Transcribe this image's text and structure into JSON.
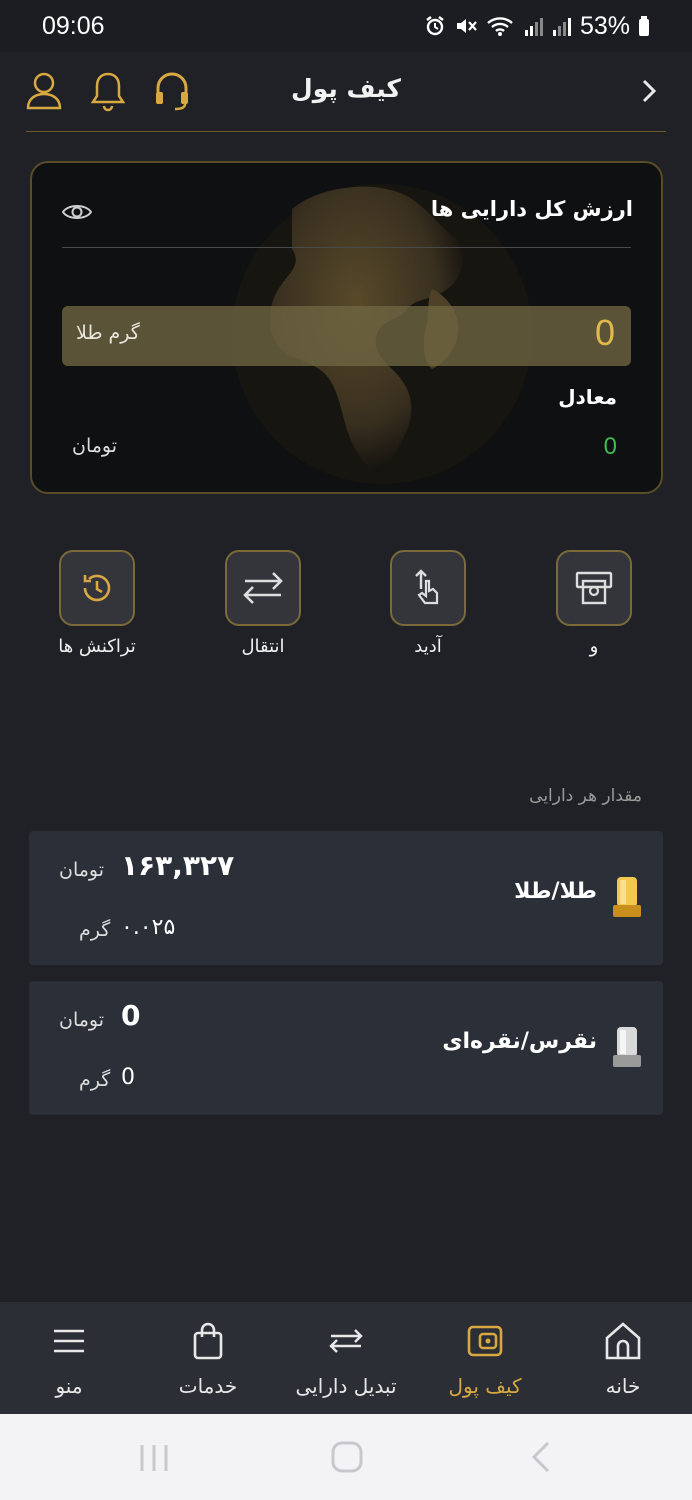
{
  "status_bar": {
    "time": "09:06",
    "battery": "53%"
  },
  "header": {
    "title": "کیف پول"
  },
  "total_card": {
    "title": "ارزش کل دارایی ها",
    "gold_amount": "0",
    "gold_unit": "گرم طلا",
    "equivalent_label": "معادل",
    "toman_value": "0",
    "toman_unit": "تومان"
  },
  "actions": [
    {
      "label": "و",
      "icon": "deposit-icon"
    },
    {
      "label": "آدید",
      "icon": "withdraw-icon"
    },
    {
      "label": "انتقال",
      "icon": "transfer-icon"
    },
    {
      "label": "تراکنش ها",
      "icon": "history-icon"
    }
  ],
  "assets_section": {
    "label": "مقدار هر دارایی",
    "items": [
      {
        "name": "طلا/طلا",
        "toman_value": "۱۶۳,۳۲۷",
        "toman_unit": "تومان",
        "grams": "۰.۰۲۵",
        "gram_unit": "گرم",
        "icon": "gold-bar-icon"
      },
      {
        "name": "نقرس/نقره‌ای",
        "toman_value": "0",
        "toman_unit": "تومان",
        "grams": "0",
        "gram_unit": "گرم",
        "icon": "silver-bar-icon"
      }
    ]
  },
  "bottom_nav": [
    {
      "label": "خانه",
      "icon": "home-icon",
      "active": false
    },
    {
      "label": "کیف پول",
      "icon": "wallet-icon",
      "active": true
    },
    {
      "label": "تبدیل دارایی",
      "icon": "exchange-icon",
      "active": false
    },
    {
      "label": "خدمات",
      "icon": "shopping-bag-icon",
      "active": false
    },
    {
      "label": "منو",
      "icon": "menu-icon",
      "active": false
    }
  ],
  "colors": {
    "accent": "#d9a941",
    "background": "#1f2126",
    "card": "#2b2f37",
    "positive": "#3fb950"
  }
}
